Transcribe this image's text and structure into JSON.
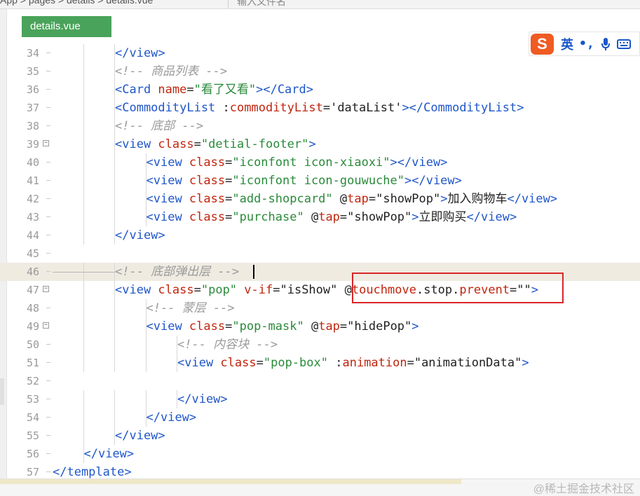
{
  "topbar": {
    "breadcrumb": "App  >  pages  >  details  >  details.vue",
    "hint": "输入文件名"
  },
  "tab": {
    "label": "details.vue"
  },
  "ime": {
    "logo": "S",
    "lang": "英",
    "punct": "•,",
    "icons": [
      "mic-icon",
      "keyboard-icon"
    ]
  },
  "watermark": "@稀土掘金技术社区",
  "colors": {
    "tag": "#1f56c8",
    "attr": "#c0260e",
    "string": "#2a8a3a",
    "comment": "#9a9a9a",
    "highlight_box": "#d8262a",
    "tab_bg": "#4aa35a"
  },
  "lines": [
    {
      "n": "34",
      "indent": 2,
      "fold": false,
      "parts": [
        [
          "tag",
          "</view>"
        ]
      ]
    },
    {
      "n": "35",
      "indent": 2,
      "fold": false,
      "parts": [
        [
          "com",
          "<!-- 商品列表 -->"
        ]
      ]
    },
    {
      "n": "36",
      "indent": 2,
      "fold": false,
      "parts": [
        [
          "tag",
          "<Card "
        ],
        [
          "attr",
          "name"
        ],
        [
          "plain",
          "="
        ],
        [
          "str",
          "\"看了又看\""
        ],
        [
          "tag",
          "></Card>"
        ]
      ]
    },
    {
      "n": "37",
      "indent": 2,
      "fold": false,
      "parts": [
        [
          "tag",
          "<CommodityList "
        ],
        [
          "plain",
          ":"
        ],
        [
          "attr",
          "commodityList"
        ],
        [
          "plain",
          "='dataList'"
        ],
        [
          "tag",
          "></CommodityList>"
        ]
      ]
    },
    {
      "n": "38",
      "indent": 2,
      "fold": false,
      "parts": [
        [
          "com",
          "<!-- 底部 -->"
        ]
      ]
    },
    {
      "n": "39",
      "indent": 2,
      "fold": true,
      "parts": [
        [
          "tag",
          "<view "
        ],
        [
          "attr",
          "class"
        ],
        [
          "plain",
          "="
        ],
        [
          "str",
          "\"detial-footer\""
        ],
        [
          "tag",
          ">"
        ]
      ]
    },
    {
      "n": "40",
      "indent": 3,
      "fold": false,
      "parts": [
        [
          "tag",
          "<view "
        ],
        [
          "attr",
          "class"
        ],
        [
          "plain",
          "="
        ],
        [
          "str",
          "\"iconfont icon-xiaoxi\""
        ],
        [
          "tag",
          "></view>"
        ]
      ]
    },
    {
      "n": "41",
      "indent": 3,
      "fold": false,
      "parts": [
        [
          "tag",
          "<view "
        ],
        [
          "attr",
          "class"
        ],
        [
          "plain",
          "="
        ],
        [
          "str",
          "\"iconfont icon-gouwuche\""
        ],
        [
          "tag",
          "></view>"
        ]
      ]
    },
    {
      "n": "42",
      "indent": 3,
      "fold": false,
      "parts": [
        [
          "tag",
          "<view "
        ],
        [
          "attr",
          "class"
        ],
        [
          "plain",
          "="
        ],
        [
          "str",
          "\"add-shopcard\""
        ],
        [
          "plain",
          " @"
        ],
        [
          "attr",
          "tap"
        ],
        [
          "plain",
          "=\"showPop\""
        ],
        [
          "tag",
          ">"
        ],
        [
          "plain",
          "加入购物车"
        ],
        [
          "tag",
          "</view>"
        ]
      ]
    },
    {
      "n": "43",
      "indent": 3,
      "fold": false,
      "parts": [
        [
          "tag",
          "<view "
        ],
        [
          "attr",
          "class"
        ],
        [
          "plain",
          "="
        ],
        [
          "str",
          "\"purchase\""
        ],
        [
          "plain",
          " @"
        ],
        [
          "attr",
          "tap"
        ],
        [
          "plain",
          "=\"showPop\""
        ],
        [
          "tag",
          ">"
        ],
        [
          "plain",
          "立即购买"
        ],
        [
          "tag",
          "</view>"
        ]
      ]
    },
    {
      "n": "44",
      "indent": 2,
      "fold": false,
      "parts": [
        [
          "tag",
          "</view>"
        ]
      ]
    },
    {
      "n": "45",
      "indent": 0,
      "fold": false,
      "parts": []
    },
    {
      "n": "46",
      "indent": 2,
      "fold": false,
      "hl": true,
      "parts": [
        [
          "com",
          "<!-- 底部弹出层 -->"
        ]
      ]
    },
    {
      "n": "47",
      "indent": 2,
      "fold": true,
      "parts": [
        [
          "tag",
          "<view "
        ],
        [
          "attr",
          "class"
        ],
        [
          "plain",
          "="
        ],
        [
          "str",
          "\"pop\""
        ],
        [
          "plain",
          " "
        ],
        [
          "attr",
          "v-if"
        ],
        [
          "plain",
          "=\"isShow\" @"
        ],
        [
          "attr",
          "touchmove"
        ],
        [
          "plain",
          ".stop."
        ],
        [
          "attr",
          "prevent"
        ],
        [
          "plain",
          "=\"\""
        ],
        [
          "tag",
          ">"
        ]
      ]
    },
    {
      "n": "48",
      "indent": 3,
      "fold": false,
      "parts": [
        [
          "com",
          "<!-- 蒙层 -->"
        ]
      ]
    },
    {
      "n": "49",
      "indent": 3,
      "fold": true,
      "parts": [
        [
          "tag",
          "<view "
        ],
        [
          "attr",
          "class"
        ],
        [
          "plain",
          "="
        ],
        [
          "str",
          "\"pop-mask\""
        ],
        [
          "plain",
          " @"
        ],
        [
          "attr",
          "tap"
        ],
        [
          "plain",
          "=\"hidePop\""
        ],
        [
          "tag",
          ">"
        ]
      ]
    },
    {
      "n": "50",
      "indent": 4,
      "fold": false,
      "parts": [
        [
          "com",
          "<!-- 内容块 -->"
        ]
      ]
    },
    {
      "n": "51",
      "indent": 4,
      "fold": false,
      "parts": [
        [
          "tag",
          "<view "
        ],
        [
          "attr",
          "class"
        ],
        [
          "plain",
          "="
        ],
        [
          "str",
          "\"pop-box\""
        ],
        [
          "plain",
          " :"
        ],
        [
          "attr",
          "animation"
        ],
        [
          "plain",
          "=\"animationData\""
        ],
        [
          "tag",
          ">"
        ]
      ]
    },
    {
      "n": "52",
      "indent": 0,
      "fold": false,
      "parts": []
    },
    {
      "n": "53",
      "indent": 4,
      "fold": false,
      "parts": [
        [
          "tag",
          "</view>"
        ]
      ]
    },
    {
      "n": "54",
      "indent": 3,
      "fold": false,
      "parts": [
        [
          "tag",
          "</view>"
        ]
      ]
    },
    {
      "n": "55",
      "indent": 2,
      "fold": false,
      "parts": [
        [
          "tag",
          "</view>"
        ]
      ]
    },
    {
      "n": "56",
      "indent": 1,
      "fold": false,
      "parts": [
        [
          "tag",
          "</view>"
        ]
      ]
    },
    {
      "n": "57",
      "indent": 0,
      "fold": false,
      "parts": [
        [
          "tag",
          "</template>"
        ]
      ]
    }
  ]
}
